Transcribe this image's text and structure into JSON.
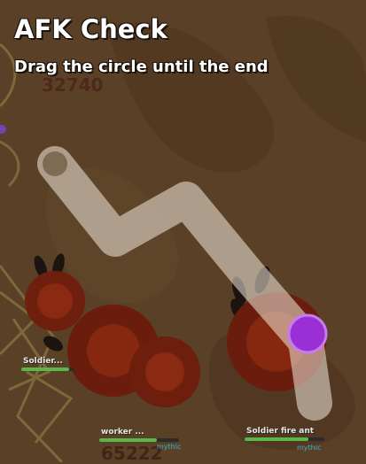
{
  "afk": {
    "title": "AFK Check",
    "instruction": "Drag the circle until the end"
  },
  "scores": {
    "top": "32740",
    "bottom": "65222"
  },
  "mobs": [
    {
      "label": "Soldier...",
      "sub": ""
    },
    {
      "label": "worker ...",
      "sub": "mythic"
    },
    {
      "label": "Soldier fire ant",
      "sub": "mythic"
    }
  ],
  "health": {
    "worker_fraction": 0.72,
    "soldier_fraction": 0.8
  },
  "colors": {
    "background": "#5a4026",
    "drag_path": "#f2eadc",
    "drag_handle": "#9b2fd6",
    "fire_ant": "#7a2210"
  }
}
